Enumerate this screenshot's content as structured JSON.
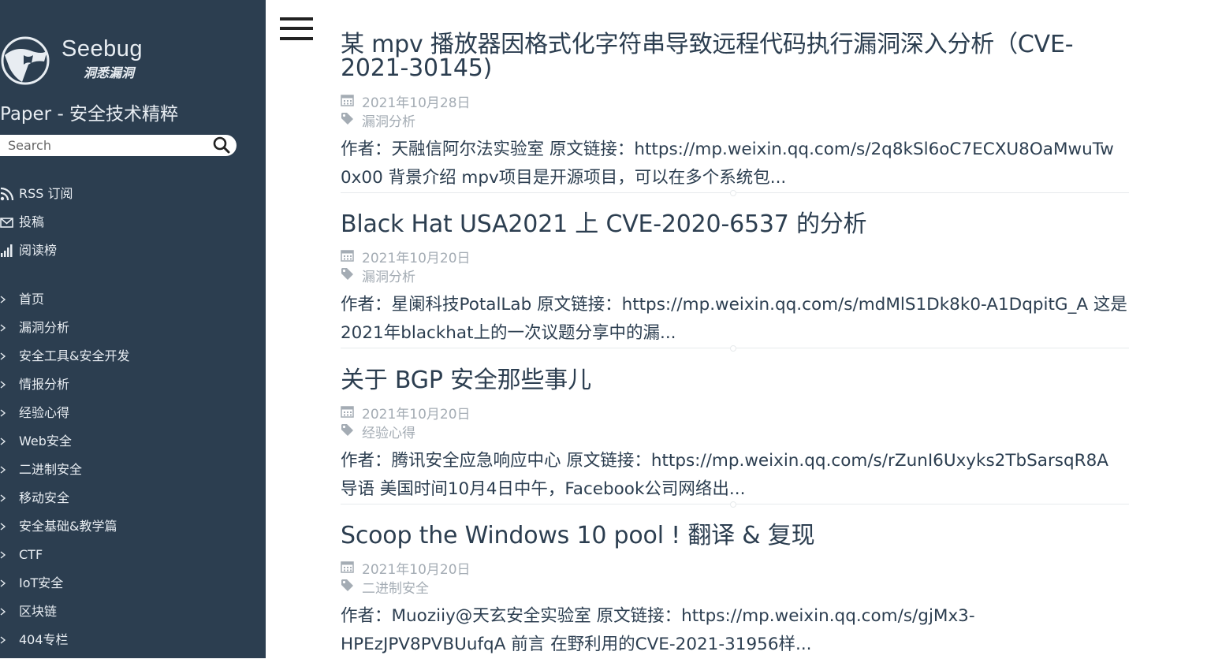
{
  "sidebar": {
    "logo_text": "Seebug",
    "logo_sub": "洞悉漏洞",
    "site_title": "Paper - 安全技术精粹",
    "search_placeholder": "Search",
    "top_links": [
      {
        "label": "RSS 订阅",
        "icon": "rss-icon"
      },
      {
        "label": "投稿",
        "icon": "envelope-icon"
      },
      {
        "label": "阅读榜",
        "icon": "bar-chart-icon"
      }
    ],
    "categories": [
      "首页",
      "漏洞分析",
      "安全工具&安全开发",
      "情报分析",
      "经验心得",
      "Web安全",
      "二进制安全",
      "移动安全",
      "安全基础&教学篇",
      "CTF",
      "IoT安全",
      "区块链",
      "404专栏"
    ]
  },
  "posts": [
    {
      "title_lines": [
        "某 mpv 播放器因格式化字符串导致远程代码执行漏洞深入分析（CVE-",
        "2021-30145)"
      ],
      "date": "2021年10月28日",
      "tag": "漏洞分析",
      "excerpt_lines": [
        "作者：天融信阿尔法实验室 原文链接：https://mp.weixin.qq.com/s/2q8kSl6oC7ECXU8OaMwuTw",
        "0x00 背景介绍 mpv项目是开源项目，可以在多个系统包..."
      ]
    },
    {
      "title_lines": [
        "Black Hat USA2021 上 CVE-2020-6537 的分析"
      ],
      "date": "2021年10月20日",
      "tag": "漏洞分析",
      "excerpt_lines": [
        "作者：星阑科技PotalLab 原文链接：https://mp.weixin.qq.com/s/mdMlS1Dk8k0-A1DqpitG_A 这是",
        "2021年blackhat上的一次议题分享中的漏..."
      ]
    },
    {
      "title_lines": [
        "关于 BGP 安全那些事儿"
      ],
      "date": "2021年10月20日",
      "tag": "经验心得",
      "excerpt_lines": [
        "作者：腾讯安全应急响应中心 原文链接：https://mp.weixin.qq.com/s/rZunI6Uxyks2TbSarsqR8A",
        "导语 美国时间10月4日中午，Facebook公司网络出..."
      ]
    },
    {
      "title_lines": [
        "Scoop the Windows 10 pool ! 翻译 & 复现"
      ],
      "date": "2021年10月20日",
      "tag": "二进制安全",
      "excerpt_lines": [
        "作者：Muoziiy@天玄安全实验室 原文链接：https://mp.weixin.qq.com/s/gjMx3-",
        "HPEzJPV8PVBUufqA 前言 在野利用的CVE-2021-31956样..."
      ]
    }
  ],
  "colors": {
    "sidebar_bg": "#2c3e50",
    "text_dark": "#2c3e50",
    "meta_gray": "#a4acb4"
  }
}
